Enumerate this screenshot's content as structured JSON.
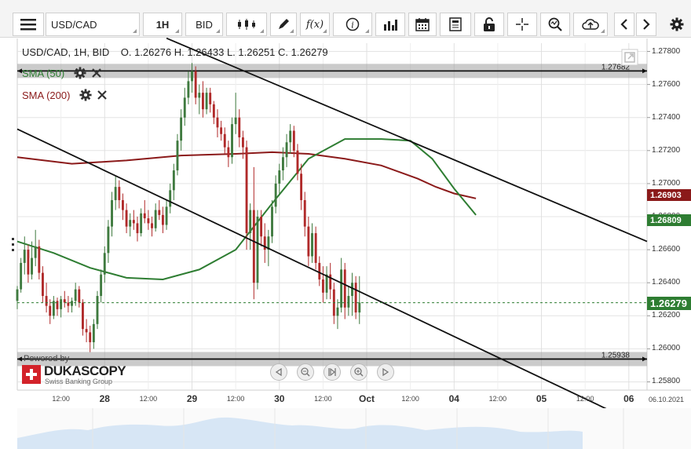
{
  "toolbar": {
    "instrument": "USD/CAD",
    "timeframe": "1H",
    "side": "BID",
    "fx_label": "f(x)",
    "info_label": "i"
  },
  "info_bar": {
    "instrument": "USD/CAD, 1H, BID",
    "o_label": "O.",
    "open": "1.26276",
    "h_label": "H.",
    "high": "1.26433",
    "l_label": "L.",
    "low": "1.26251",
    "c_label": "C.",
    "close": "1.26279"
  },
  "indicators": [
    {
      "name": "SMA (50)",
      "color": "#2e7d32"
    },
    {
      "name": "SMA (200)",
      "color": "#8b1a1a"
    }
  ],
  "branding": {
    "powered_by": "Powered by",
    "name": "DUKASCOPY",
    "tagline": "Swiss Banking Group"
  },
  "date_stamp": "06.10.2021",
  "chart_data": {
    "type": "candlestick",
    "ylim": [
      1.2575,
      1.2785
    ],
    "y_ticks": [
      "1.27800",
      "1.27600",
      "1.27400",
      "1.27200",
      "1.27000",
      "1.26800",
      "1.26600",
      "1.26400",
      "1.26200",
      "1.26000",
      "1.25800"
    ],
    "x_ticks": [
      {
        "label": "12:00",
        "t": 12,
        "major": false
      },
      {
        "label": "28",
        "t": 24,
        "major": true
      },
      {
        "label": "12:00",
        "t": 36,
        "major": false
      },
      {
        "label": "29",
        "t": 48,
        "major": true
      },
      {
        "label": "12:00",
        "t": 60,
        "major": false
      },
      {
        "label": "30",
        "t": 72,
        "major": true
      },
      {
        "label": "12:00",
        "t": 84,
        "major": false
      },
      {
        "label": "Oct",
        "t": 96,
        "major": true
      },
      {
        "label": "12:00",
        "t": 108,
        "major": false
      },
      {
        "label": "04",
        "t": 120,
        "major": true
      },
      {
        "label": "12:00",
        "t": 132,
        "major": false
      },
      {
        "label": "05",
        "t": 144,
        "major": true
      },
      {
        "label": "12:00",
        "t": 156,
        "major": false
      },
      {
        "label": "06",
        "t": 168,
        "major": true
      }
    ],
    "x_range": [
      0,
      173
    ],
    "horizontal_lines": [
      {
        "value": 1.27682,
        "label": "1.27682",
        "style": "solid"
      },
      {
        "value": 1.25938,
        "label": "1.25938",
        "style": "solid"
      }
    ],
    "price_tags": [
      {
        "label": "1.26903",
        "value": 1.26903,
        "color": "#8b1a1a"
      },
      {
        "label": "1.26809",
        "value": 1.26809,
        "color": "#2e7d32"
      },
      {
        "label": "1.26279",
        "value": 1.26279,
        "color": "#2e7d32"
      }
    ],
    "current_price": 1.26279,
    "trendlines": [
      {
        "points": [
          [
            41,
            1.2788
          ],
          [
            173,
            1.2665
          ]
        ]
      },
      {
        "points": [
          [
            0,
            1.2733
          ],
          [
            173,
            1.2552
          ]
        ]
      }
    ],
    "sma50": [
      [
        0,
        1.2665
      ],
      [
        10,
        1.2658
      ],
      [
        20,
        1.2649
      ],
      [
        30,
        1.2643
      ],
      [
        40,
        1.2642
      ],
      [
        50,
        1.2648
      ],
      [
        60,
        1.266
      ],
      [
        70,
        1.2688
      ],
      [
        80,
        1.2715
      ],
      [
        90,
        1.2727
      ],
      [
        100,
        1.2727
      ],
      [
        108,
        1.2726
      ],
      [
        114,
        1.2715
      ],
      [
        120,
        1.2697
      ],
      [
        126,
        1.2681
      ]
    ],
    "sma200": [
      [
        0,
        1.2716
      ],
      [
        15,
        1.2712
      ],
      [
        30,
        1.2714
      ],
      [
        45,
        1.2717
      ],
      [
        60,
        1.2718
      ],
      [
        70,
        1.2719
      ],
      [
        80,
        1.2718
      ],
      [
        90,
        1.2715
      ],
      [
        100,
        1.2711
      ],
      [
        105,
        1.2707
      ],
      [
        110,
        1.2703
      ],
      [
        115,
        1.2698
      ],
      [
        120,
        1.2694
      ],
      [
        126,
        1.2691
      ]
    ],
    "candles": [
      [
        0,
        1.2629,
        1.2638,
        1.2624,
        1.2636
      ],
      [
        1,
        1.2636,
        1.2655,
        1.2634,
        1.2652
      ],
      [
        2,
        1.2652,
        1.2668,
        1.2645,
        1.266
      ],
      [
        3,
        1.266,
        1.2663,
        1.264,
        1.2645
      ],
      [
        4,
        1.2645,
        1.2665,
        1.2642,
        1.2655
      ],
      [
        5,
        1.2655,
        1.2672,
        1.265,
        1.2662
      ],
      [
        6,
        1.2662,
        1.2666,
        1.2642,
        1.2646
      ],
      [
        7,
        1.2646,
        1.265,
        1.2628,
        1.2632
      ],
      [
        8,
        1.2632,
        1.264,
        1.2622,
        1.2626
      ],
      [
        9,
        1.2626,
        1.263,
        1.2615,
        1.262
      ],
      [
        10,
        1.262,
        1.2632,
        1.2618,
        1.2629
      ],
      [
        11,
        1.2629,
        1.2631,
        1.262,
        1.2624
      ],
      [
        12,
        1.2624,
        1.2632,
        1.2619,
        1.263
      ],
      [
        13,
        1.263,
        1.2635,
        1.2625,
        1.2628
      ],
      [
        14,
        1.2628,
        1.2632,
        1.2622,
        1.2626
      ],
      [
        15,
        1.2626,
        1.2631,
        1.2622,
        1.2629
      ],
      [
        16,
        1.2629,
        1.264,
        1.2626,
        1.2636
      ],
      [
        17,
        1.2636,
        1.2638,
        1.2625,
        1.2628
      ],
      [
        18,
        1.2628,
        1.263,
        1.2608,
        1.2612
      ],
      [
        19,
        1.2612,
        1.2618,
        1.2604,
        1.261
      ],
      [
        20,
        1.261,
        1.2614,
        1.2598,
        1.2604
      ],
      [
        21,
        1.2604,
        1.2618,
        1.26,
        1.2615
      ],
      [
        22,
        1.2615,
        1.2635,
        1.2612,
        1.2632
      ],
      [
        23,
        1.2632,
        1.2648,
        1.2628,
        1.2645
      ],
      [
        24,
        1.2645,
        1.2662,
        1.264,
        1.2658
      ],
      [
        25,
        1.2658,
        1.2678,
        1.2652,
        1.2674
      ],
      [
        26,
        1.2674,
        1.2695,
        1.2668,
        1.269
      ],
      [
        27,
        1.269,
        1.2705,
        1.2684,
        1.2698
      ],
      [
        28,
        1.2698,
        1.2702,
        1.2685,
        1.269
      ],
      [
        29,
        1.269,
        1.2694,
        1.2678,
        1.2684
      ],
      [
        30,
        1.2684,
        1.2688,
        1.267,
        1.2674
      ],
      [
        31,
        1.2674,
        1.2682,
        1.2668,
        1.2678
      ],
      [
        32,
        1.2678,
        1.2684,
        1.2672,
        1.2676
      ],
      [
        33,
        1.2676,
        1.268,
        1.2665,
        1.267
      ],
      [
        34,
        1.267,
        1.2685,
        1.2668,
        1.2682
      ],
      [
        35,
        1.2682,
        1.269,
        1.2676,
        1.2679
      ],
      [
        36,
        1.2679,
        1.2684,
        1.2672,
        1.2676
      ],
      [
        37,
        1.2676,
        1.268,
        1.2668,
        1.2673
      ],
      [
        38,
        1.2673,
        1.2688,
        1.2671,
        1.2684
      ],
      [
        39,
        1.2684,
        1.269,
        1.2678,
        1.2681
      ],
      [
        40,
        1.2681,
        1.2686,
        1.267,
        1.2675
      ],
      [
        41,
        1.2675,
        1.269,
        1.2672,
        1.2686
      ],
      [
        42,
        1.2686,
        1.27,
        1.2682,
        1.2696
      ],
      [
        43,
        1.2696,
        1.2712,
        1.269,
        1.2708
      ],
      [
        44,
        1.2708,
        1.273,
        1.2705,
        1.2726
      ],
      [
        45,
        1.2726,
        1.2745,
        1.272,
        1.274
      ],
      [
        46,
        1.274,
        1.2758,
        1.2735,
        1.2752
      ],
      [
        47,
        1.2752,
        1.2768,
        1.2748,
        1.2762
      ],
      [
        48,
        1.2762,
        1.2773,
        1.2755,
        1.2768
      ],
      [
        49,
        1.2768,
        1.2771,
        1.2748,
        1.2752
      ],
      [
        50,
        1.2752,
        1.276,
        1.2742,
        1.2755
      ],
      [
        51,
        1.2755,
        1.2762,
        1.274,
        1.2745
      ],
      [
        52,
        1.2745,
        1.2758,
        1.2742,
        1.2755
      ],
      [
        53,
        1.2755,
        1.2758,
        1.2743,
        1.2748
      ],
      [
        54,
        1.2748,
        1.275,
        1.2736,
        1.274
      ],
      [
        55,
        1.274,
        1.2745,
        1.2728,
        1.2734
      ],
      [
        56,
        1.2734,
        1.2738,
        1.2726,
        1.273
      ],
      [
        57,
        1.273,
        1.2734,
        1.2718,
        1.2722
      ],
      [
        58,
        1.2722,
        1.2726,
        1.271,
        1.2716
      ],
      [
        59,
        1.2716,
        1.274,
        1.2712,
        1.2736
      ],
      [
        60,
        1.2736,
        1.2755,
        1.273,
        1.274
      ],
      [
        61,
        1.274,
        1.2745,
        1.2722,
        1.2728
      ],
      [
        62,
        1.2728,
        1.2732,
        1.2715,
        1.2722
      ],
      [
        63,
        1.2722,
        1.2726,
        1.266,
        1.267
      ],
      [
        64,
        1.267,
        1.2688,
        1.266,
        1.2684
      ],
      [
        65,
        1.2684,
        1.271,
        1.263,
        1.264
      ],
      [
        66,
        1.264,
        1.2684,
        1.2636,
        1.268
      ],
      [
        67,
        1.268,
        1.2684,
        1.2662,
        1.2668
      ],
      [
        68,
        1.2668,
        1.2676,
        1.2652,
        1.266
      ],
      [
        69,
        1.266,
        1.2672,
        1.265,
        1.2668
      ],
      [
        70,
        1.2668,
        1.269,
        1.2664,
        1.2686
      ],
      [
        71,
        1.2686,
        1.2705,
        1.2682,
        1.27
      ],
      [
        72,
        1.27,
        1.2712,
        1.2694,
        1.2708
      ],
      [
        73,
        1.2708,
        1.2722,
        1.2702,
        1.2716
      ],
      [
        74,
        1.2716,
        1.273,
        1.271,
        1.2725
      ],
      [
        75,
        1.2725,
        1.2736,
        1.2718,
        1.2732
      ],
      [
        76,
        1.2732,
        1.2735,
        1.2716,
        1.272
      ],
      [
        77,
        1.272,
        1.2724,
        1.2702,
        1.2706
      ],
      [
        78,
        1.2706,
        1.2712,
        1.2684,
        1.269
      ],
      [
        79,
        1.269,
        1.2695,
        1.2668,
        1.2674
      ],
      [
        80,
        1.2674,
        1.268,
        1.265,
        1.2656
      ],
      [
        81,
        1.2656,
        1.2676,
        1.2652,
        1.267
      ],
      [
        82,
        1.267,
        1.2674,
        1.2648,
        1.2652
      ],
      [
        83,
        1.2652,
        1.2656,
        1.2638,
        1.2642
      ],
      [
        84,
        1.2642,
        1.265,
        1.2628,
        1.2634
      ],
      [
        85,
        1.2634,
        1.265,
        1.263,
        1.2645
      ],
      [
        86,
        1.2645,
        1.2652,
        1.263,
        1.2636
      ],
      [
        87,
        1.2636,
        1.264,
        1.2615,
        1.262
      ],
      [
        88,
        1.262,
        1.263,
        1.2612,
        1.2625
      ],
      [
        89,
        1.2625,
        1.2655,
        1.2622,
        1.2648
      ],
      [
        90,
        1.2648,
        1.2652,
        1.2618,
        1.2625
      ],
      [
        91,
        1.2625,
        1.2638,
        1.262,
        1.2632
      ],
      [
        92,
        1.2632,
        1.2646,
        1.262,
        1.264
      ],
      [
        93,
        1.264,
        1.2644,
        1.2618,
        1.2622
      ],
      [
        94,
        1.2622,
        1.2644,
        1.2615,
        1.2628
      ]
    ]
  }
}
